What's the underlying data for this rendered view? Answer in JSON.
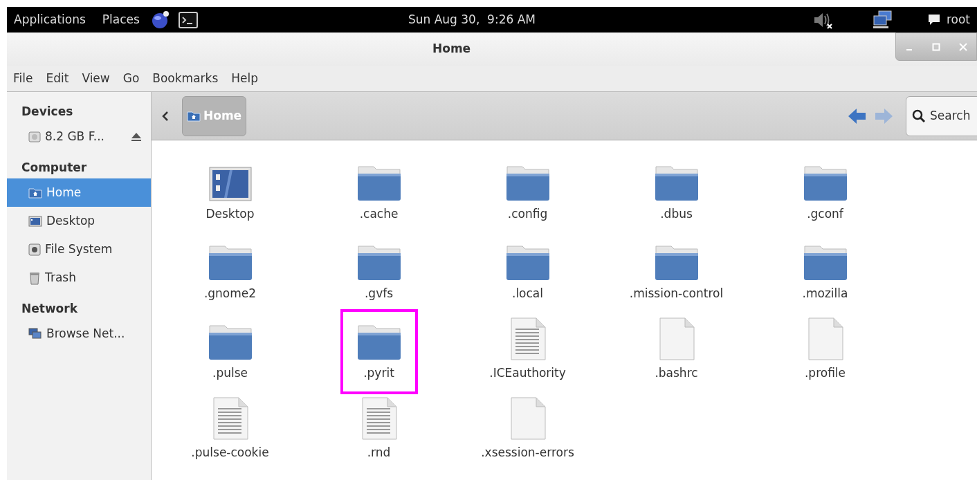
{
  "top_bar": {
    "menus": [
      "Applications",
      "Places"
    ],
    "clock": "Sun Aug 30,  9:26 AM",
    "user": "root"
  },
  "window": {
    "title": "Home"
  },
  "menu_bar": [
    "File",
    "Edit",
    "View",
    "Go",
    "Bookmarks",
    "Help"
  ],
  "sidebar": [
    {
      "heading": "Devices",
      "items": [
        {
          "label": "8.2 GB F...",
          "eject": true,
          "selected": false
        }
      ]
    },
    {
      "heading": "Computer",
      "items": [
        {
          "label": "Home",
          "eject": false,
          "selected": true
        },
        {
          "label": "Desktop",
          "eject": false,
          "selected": false
        },
        {
          "label": "File System",
          "eject": false,
          "selected": false
        },
        {
          "label": "Trash",
          "eject": false,
          "selected": false
        }
      ]
    },
    {
      "heading": "Network",
      "items": [
        {
          "label": "Browse Net...",
          "eject": false,
          "selected": false
        }
      ]
    }
  ],
  "toolbar": {
    "path": "Home",
    "search": "Search"
  },
  "files": [
    {
      "name": "Desktop",
      "kind": "desktop",
      "highlighted": false
    },
    {
      "name": ".cache",
      "kind": "folder",
      "highlighted": false
    },
    {
      "name": ".config",
      "kind": "folder",
      "highlighted": false
    },
    {
      "name": ".dbus",
      "kind": "folder",
      "highlighted": false
    },
    {
      "name": ".gconf",
      "kind": "folder",
      "highlighted": false
    },
    {
      "name": ".gnome2",
      "kind": "folder",
      "highlighted": false
    },
    {
      "name": ".gvfs",
      "kind": "folder",
      "highlighted": false
    },
    {
      "name": ".local",
      "kind": "folder",
      "highlighted": false
    },
    {
      "name": ".mission-control",
      "kind": "folder",
      "highlighted": false
    },
    {
      "name": ".mozilla",
      "kind": "folder",
      "highlighted": false
    },
    {
      "name": ".pulse",
      "kind": "folder",
      "highlighted": false
    },
    {
      "name": ".pyrit",
      "kind": "folder",
      "highlighted": true
    },
    {
      "name": ".ICEauthority",
      "kind": "text",
      "highlighted": false
    },
    {
      "name": ".bashrc",
      "kind": "blank",
      "highlighted": false
    },
    {
      "name": ".profile",
      "kind": "blank",
      "highlighted": false
    },
    {
      "name": ".pulse-cookie",
      "kind": "text",
      "highlighted": false
    },
    {
      "name": ".rnd",
      "kind": "text",
      "highlighted": false
    },
    {
      "name": ".xsession-errors",
      "kind": "blank",
      "highlighted": false
    }
  ]
}
